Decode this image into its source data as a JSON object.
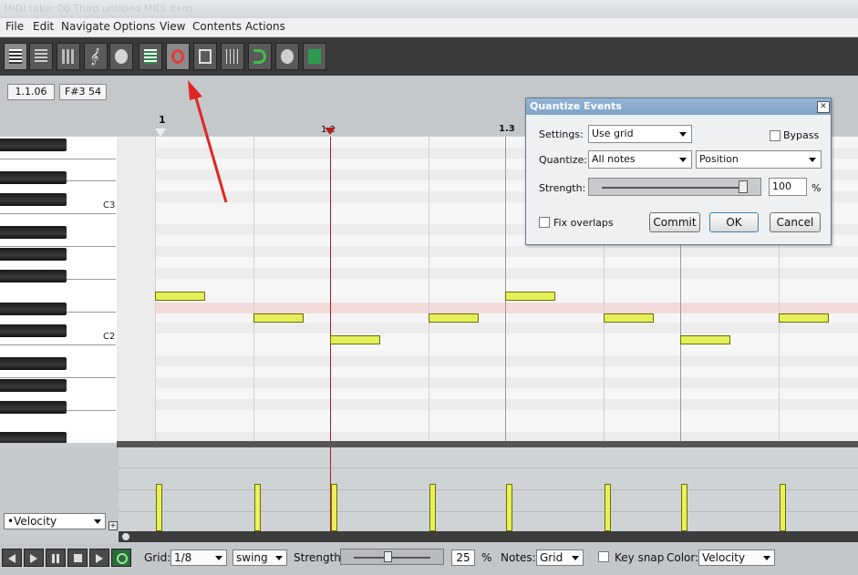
{
  "window": {
    "title": "MIDI take: 06 Third untitled MIDI item"
  },
  "menu": [
    "File",
    "Edit",
    "Navigate",
    "Options",
    "View",
    "Contents",
    "Actions"
  ],
  "toolbar": {
    "buttons": [
      {
        "name": "piano-roll-icon"
      },
      {
        "name": "named-notes-icon"
      },
      {
        "name": "event-list-icon"
      },
      {
        "name": "treble-clef-icon"
      },
      {
        "name": "palette-icon"
      },
      {
        "name": "editor-icon"
      },
      {
        "name": "grid-view-icon"
      },
      {
        "name": "quantize-icon"
      },
      {
        "name": "toolbox-icon"
      },
      {
        "name": "dots-grid-icon"
      },
      {
        "name": "loop-icon"
      },
      {
        "name": "color-palette-icon"
      },
      {
        "name": "download-icon"
      }
    ],
    "highlight_color": "#e23b3b"
  },
  "readouts": {
    "position": "1.1.06",
    "note": "F#3  54"
  },
  "ruler": {
    "bar1": "1",
    "bar2": "1.2",
    "bar3": "1.3"
  },
  "piano": {
    "label_c3": "C3",
    "label_c2": "C2"
  },
  "dialog": {
    "title": "Quantize Events",
    "settings_label": "Settings:",
    "settings_value": "Use grid",
    "bypass_label": "Bypass",
    "quantize_label": "Quantize:",
    "quantize_value": "All notes",
    "position_value": "Position",
    "strength_label": "Strength:",
    "strength_value": "100",
    "strength_level": 0.94,
    "percent": "%",
    "fix_overlaps_label": "Fix overlaps",
    "commit_label": "Commit",
    "ok_label": "OK",
    "cancel_label": "Cancel"
  },
  "cc_lane": {
    "selector": "•Velocity"
  },
  "bottom": {
    "grid_label": "Grid:",
    "grid_value": "1/8",
    "swing_value": "swing",
    "strength_label": "Strength:",
    "strength_value": "25",
    "strength_level": 0.45,
    "percent": "%",
    "notes_label": "Notes:",
    "notes_value": "Grid",
    "keysnap_label": "Key snap",
    "color_label": "Color:",
    "color_value": "Velocity"
  },
  "colors": {
    "note": "#e4f05a",
    "playhead": "#b02020",
    "arrow": "#e02424"
  }
}
